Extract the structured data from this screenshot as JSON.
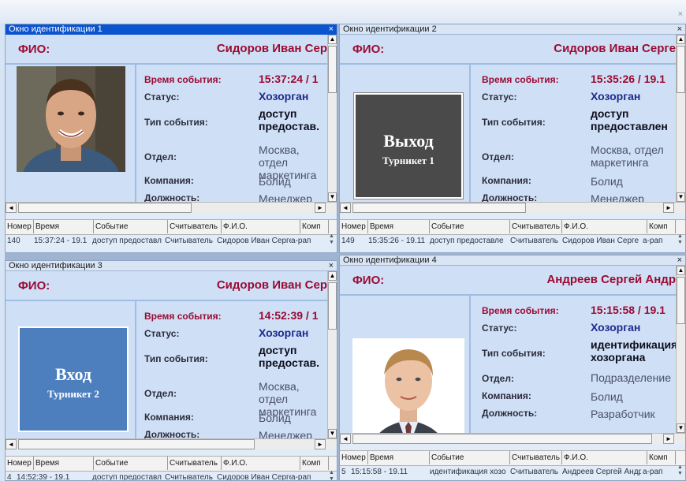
{
  "labels": {
    "fio": "ФИО:",
    "event_time": "Время события:",
    "status": "Статус:",
    "event_type": "Тип события:",
    "department": "Отдел:",
    "company": "Компания:",
    "position": "Должность:"
  },
  "grid_columns": [
    "Номер",
    "Время",
    "Событие",
    "Считыватель",
    "Ф.И.О.",
    "Комп"
  ],
  "panels": [
    {
      "title": "Окно идентификации 1",
      "name": "Сидоров Иван Сер",
      "time": "15:37:24 / 1",
      "status": "Хозорган",
      "event_type": "доступ предостав.",
      "department": "Москва, отдел маркетинга",
      "company": "Болид",
      "position": "Менеджер",
      "row": {
        "num": "140",
        "time": "15:37:24 - 19.1",
        "event": "доступ предоставл",
        "reader": "Считыватель",
        "fio": "Сидоров Иван Серге",
        "comp": "а-рап"
      }
    },
    {
      "title": "Окно идентификации 2",
      "name": "Сидоров Иван Серге",
      "time": "15:35:26 / 19.1",
      "status": "Хозорган",
      "event_type": "доступ предоставлен",
      "department": "Москва, отдел маркетинга",
      "company": "Болид",
      "position": "Менеджер",
      "tile_big": "Выход",
      "tile_small": "Турникет 1",
      "row": {
        "num": "149",
        "time": "15:35:26 - 19.11",
        "event": "доступ предоставле",
        "reader": "Считыватель",
        "fio": "Сидоров Иван Серге",
        "comp": "а-рап"
      }
    },
    {
      "title": "Окно идентификации 3",
      "name": "Сидоров Иван Сер",
      "time": "14:52:39 / 1",
      "status": "Хозорган",
      "event_type": "доступ предостав.",
      "department": "Москва, отдел маркетинга",
      "company": "Болид",
      "position": "Менеджер",
      "tile_big": "Вход",
      "tile_small": "Турникет 2",
      "row": {
        "num": "4",
        "time": "14:52:39 - 19.1",
        "event": "доступ предоставл",
        "reader": "Считыватель",
        "fio": "Сидоров Иван Серге",
        "comp": "а-рап"
      }
    },
    {
      "title": "Окно идентификации 4",
      "name": "Андреев Сергей Андр",
      "time": "15:15:58 / 19.1",
      "status": "Хозорган",
      "event_type": "идентификация хозоргана",
      "department": "Подразделение",
      "company": "Болид",
      "position": "Разработчик",
      "row": {
        "num": "5",
        "time": "15:15:58 - 19.11",
        "event": "идентификация хозо",
        "reader": "Считыватель",
        "fio": "Андреев Сергей Андр",
        "comp": "а-рап"
      }
    }
  ],
  "colors": {
    "active_title": "#0a54cf",
    "accent_red": "#9b0a32",
    "status_navy": "#1e2a8c",
    "card_bg": "#cfe0f6"
  },
  "icons": [
    "close-icon",
    "scroll-up-icon",
    "scroll-down-icon",
    "scroll-left-icon",
    "scroll-right-icon"
  ]
}
